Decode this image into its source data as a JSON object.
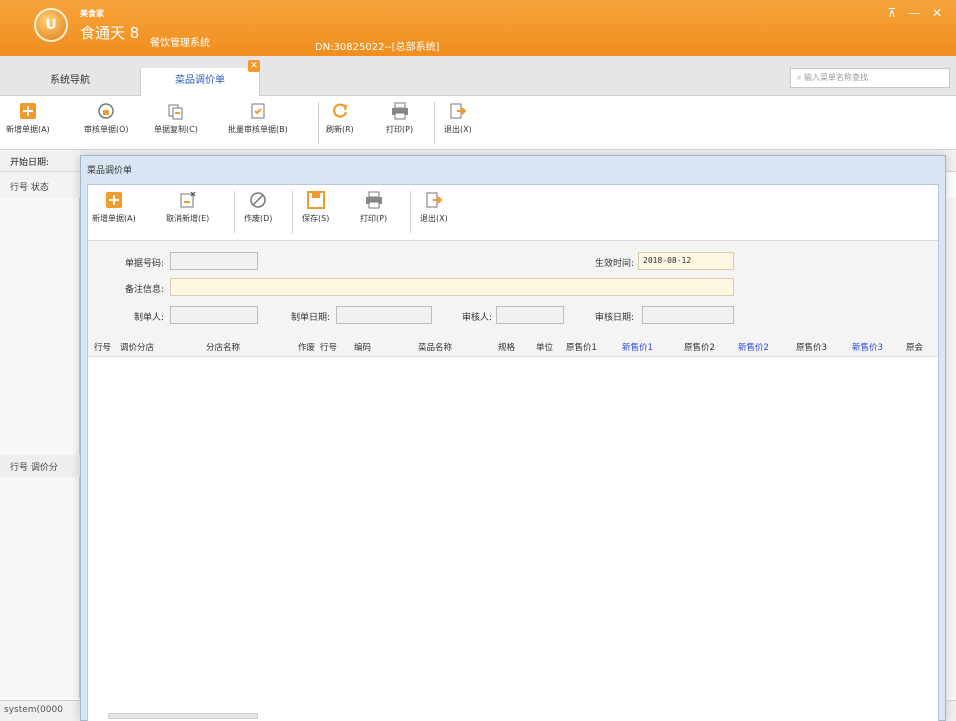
{
  "app": {
    "logo_glyph": "U",
    "brand_small": "美食家",
    "brand_main": "食通天 8",
    "brand_sub": "餐饮管理系统",
    "dn_text": "DN:30825022--[总部系统]",
    "window_controls": "⊼ — ✕"
  },
  "tabs": {
    "nav_label": "系统导航",
    "active_label": "菜品调价单",
    "close_glyph": "✕",
    "search_placeholder": "输入菜单名称查找"
  },
  "main_toolbar": {
    "buttons": [
      {
        "label": "新增单据(A)",
        "icon": "plus-icon"
      },
      {
        "label": "审核单据(O)",
        "icon": "stamp-icon"
      },
      {
        "label": "单据复制(C)",
        "icon": "copy-icon"
      },
      {
        "label": "批量审核单据(B)",
        "icon": "batch-approve-icon"
      },
      {
        "label": "刷新(R)",
        "icon": "refresh-icon"
      },
      {
        "label": "打印(P)",
        "icon": "printer-icon"
      },
      {
        "label": "退出(X)",
        "icon": "exit-icon"
      }
    ]
  },
  "filter": {
    "start_date_label": "开始日期:"
  },
  "side": {
    "head_text": "行号  状态",
    "row2_text": "行号  调价分",
    "status_text": "system(0000"
  },
  "dialog": {
    "title": "菜品调价单",
    "toolbar": [
      {
        "label": "新增单据(A)",
        "icon": "plus-icon"
      },
      {
        "label": "取消新增(E)",
        "icon": "cancel-new-icon"
      },
      {
        "label": "作废(D)",
        "icon": "void-icon"
      },
      {
        "label": "保存(S)",
        "icon": "save-icon"
      },
      {
        "label": "打印(P)",
        "icon": "printer-icon"
      },
      {
        "label": "退出(X)",
        "icon": "exit-icon"
      }
    ],
    "form": {
      "doc_no_label": "单据号码:",
      "doc_no_value": "",
      "effective_time_label": "生效时间:",
      "effective_time_value": "2018-08-12",
      "remark_label": "备注信息:",
      "remark_value": "",
      "maker_label": "制单人:",
      "maker_value": "",
      "make_date_label": "制单日期:",
      "make_date_value": "",
      "auditor_label": "审核人:",
      "auditor_value": "",
      "audit_date_label": "审核日期:",
      "audit_date_value": ""
    },
    "columns": [
      {
        "label": "行号",
        "color": "#333333"
      },
      {
        "label": "调价分店",
        "color": "#333333"
      },
      {
        "label": "分店名称",
        "color": "#333333"
      },
      {
        "label": "作废",
        "color": "#333333"
      },
      {
        "label": "行号",
        "color": "#333333"
      },
      {
        "label": "编码",
        "color": "#333333"
      },
      {
        "label": "菜品名称",
        "color": "#333333"
      },
      {
        "label": "规格",
        "color": "#333333"
      },
      {
        "label": "单位",
        "color": "#333333"
      },
      {
        "label": "原售价1",
        "color": "#333333"
      },
      {
        "label": "新售价1",
        "color": "#2a46e0"
      },
      {
        "label": "原售价2",
        "color": "#333333"
      },
      {
        "label": "新售价2",
        "color": "#2a46e0"
      },
      {
        "label": "原售价3",
        "color": "#333333"
      },
      {
        "label": "新售价3",
        "color": "#2a46e0"
      },
      {
        "label": "原会",
        "color": "#333333"
      }
    ]
  },
  "colors": {
    "titlebar": "#f08e1e",
    "active_tab_text": "#2a5bbf",
    "new_price_column": "#2a46e0"
  }
}
